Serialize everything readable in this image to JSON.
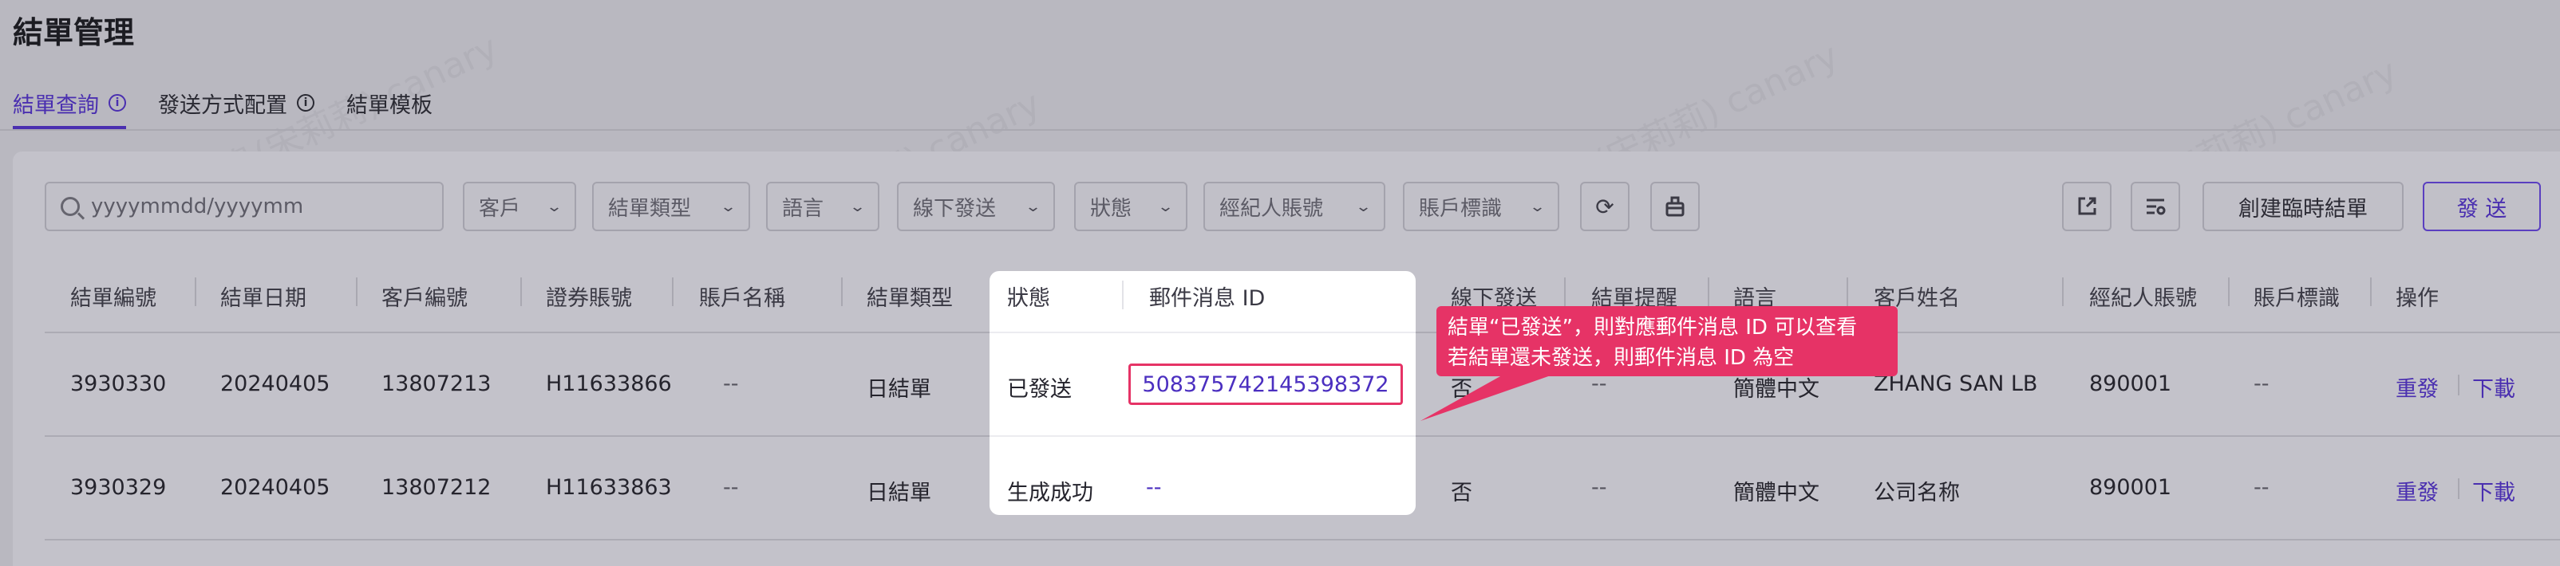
{
  "page": {
    "title": "結單管理"
  },
  "tabs": [
    {
      "label": "結單查詢",
      "has_info": true
    },
    {
      "label": "發送方式配置",
      "has_info": true
    },
    {
      "label": "結單模板",
      "has_info": false
    }
  ],
  "filters": {
    "search_placeholder": "yyyymmdd/yyyymm",
    "selects": [
      "客戶",
      "結單類型",
      "語言",
      "線下發送",
      "狀態",
      "經紀人賬號",
      "賬戶標識"
    ]
  },
  "toolbar": {
    "create_temp_label": "創建臨時結單",
    "send_label": "發 送"
  },
  "table": {
    "headers": [
      "結單編號",
      "結單日期",
      "客戶編號",
      "證券賬號",
      "賬戶名稱",
      "結單類型",
      "狀態",
      "郵件消息 ID",
      "線下發送",
      "結單提醒",
      "語言",
      "客戶姓名",
      "經紀人賬號",
      "賬戶標識",
      "操作"
    ],
    "rows": [
      {
        "no": "3930330",
        "date": "20240405",
        "client": "13807213",
        "account": "H11633866",
        "acc_name": "--",
        "type": "日結單",
        "status": "已發送",
        "msg_id": "508375742145398372",
        "offline": "否",
        "remind": "--",
        "lang": "簡體中文",
        "client_name": "ZHANG SAN LB",
        "broker": "890001",
        "flag": "--",
        "act1": "重發",
        "act2": "下載"
      },
      {
        "no": "3930329",
        "date": "20240405",
        "client": "13807212",
        "account": "H11633863",
        "acc_name": "--",
        "type": "日結單",
        "status": "生成成功",
        "msg_id": "--",
        "offline": "否",
        "remind": "--",
        "lang": "簡體中文",
        "client_name": "公司名称",
        "broker": "890001",
        "flag": "--",
        "act1": "重發",
        "act2": "下載"
      }
    ]
  },
  "callout": {
    "line1": "結單“已發送”，則對應郵件消息 ID 可以查看",
    "line2": "若結單還未發送，則郵件消息 ID 為空"
  },
  "watermark": "王鳥(宋莉莉) canary",
  "colors": {
    "accent": "#4a2fb0",
    "callout": "#e63366",
    "overlay": "#b9b8c0"
  }
}
